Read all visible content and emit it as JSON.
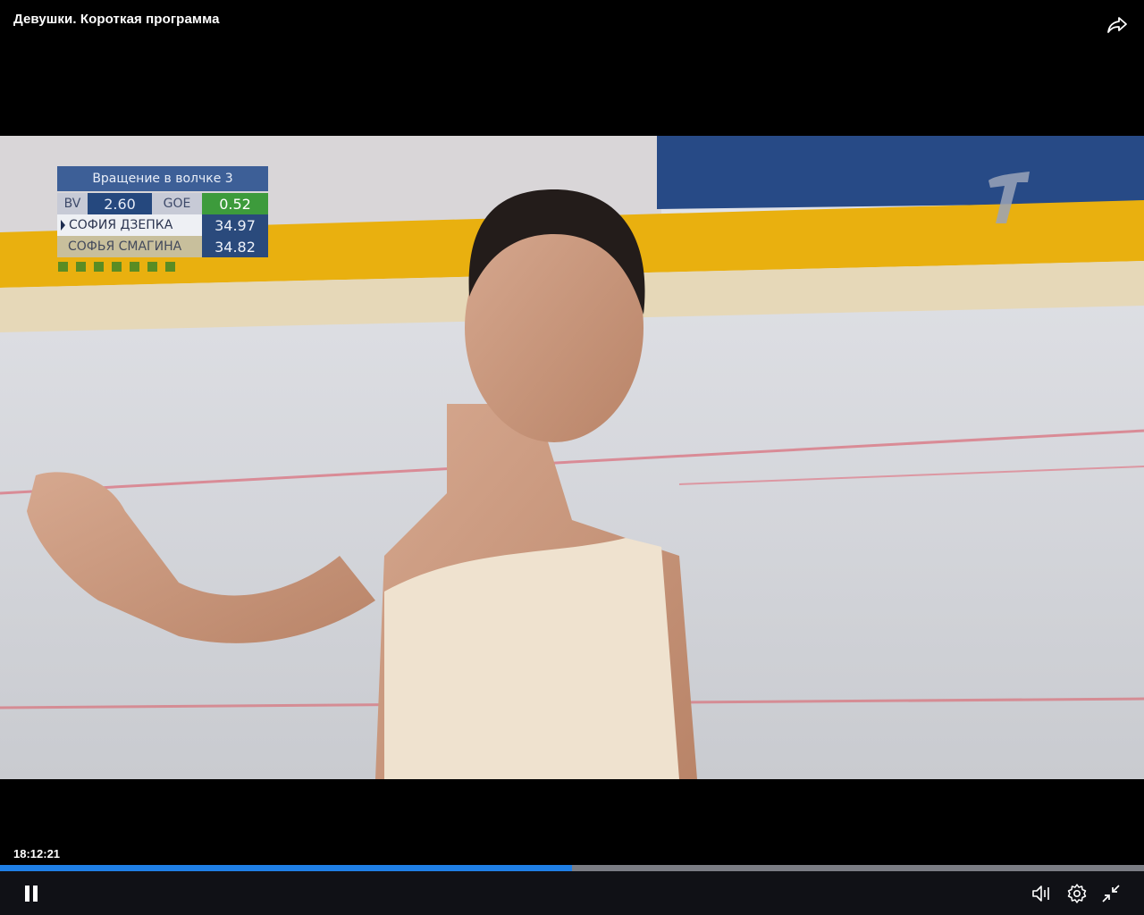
{
  "header": {
    "title": "Девушки. Короткая программа"
  },
  "scoreboard": {
    "element": "Вращение в волчке 3",
    "bv_label": "BV",
    "bv_value": "2.60",
    "goe_label": "GOE",
    "goe_value": "0.52",
    "rows": [
      {
        "name": "СОФИЯ ДЗЕПКА",
        "score": "34.97"
      },
      {
        "name": "СОФЬЯ СМАГИНА",
        "score": "34.82"
      }
    ]
  },
  "player": {
    "timestamp": "18:12:21",
    "progress": 0.5,
    "progress_color": "#1f7fe6"
  },
  "icons": {
    "share": "share-icon",
    "pause": "pause-icon",
    "volume": "volume-icon",
    "settings": "gear-icon",
    "exit_fullscreen": "collapse-icon",
    "channel": "channel-one-logo"
  }
}
